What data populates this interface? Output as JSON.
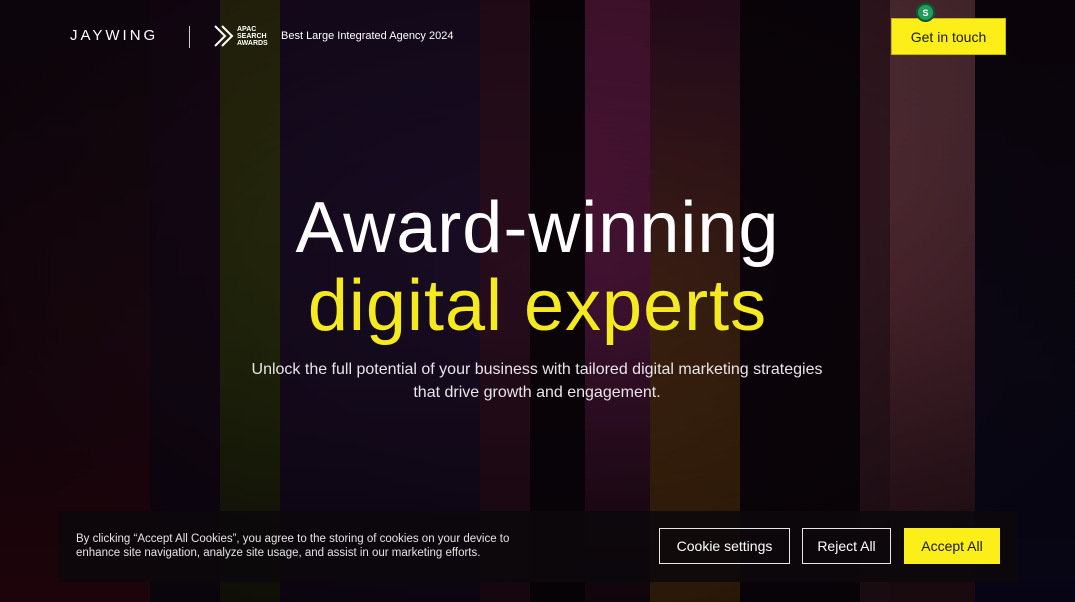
{
  "header": {
    "logo": "JAYWING",
    "award_logo_text": "APAC SEARCH AWARDS",
    "award_label": "Best Large Integrated Agency 2024",
    "cta_label": "Get in touch",
    "badge_letter": "S"
  },
  "hero": {
    "headline_line1": "Award-winning",
    "headline_line2": "digital experts",
    "subtitle": "Unlock the full potential of your business with tailored digital marketing strategies that drive growth and engagement."
  },
  "cookie_banner": {
    "text": "By clicking “Accept All Cookies”, you agree to the storing of cookies on your device to enhance site navigation, analyze site usage, and assist in our marketing efforts.",
    "settings_label": "Cookie settings",
    "reject_label": "Reject All",
    "accept_label": "Accept All"
  },
  "colors": {
    "accent_yellow": "#fbee19",
    "headline_yellow": "#f5ea20",
    "text_white": "#ffffff"
  },
  "icons": {
    "award": "chevron-double-right-icon",
    "badge": "extension-badge-icon"
  }
}
